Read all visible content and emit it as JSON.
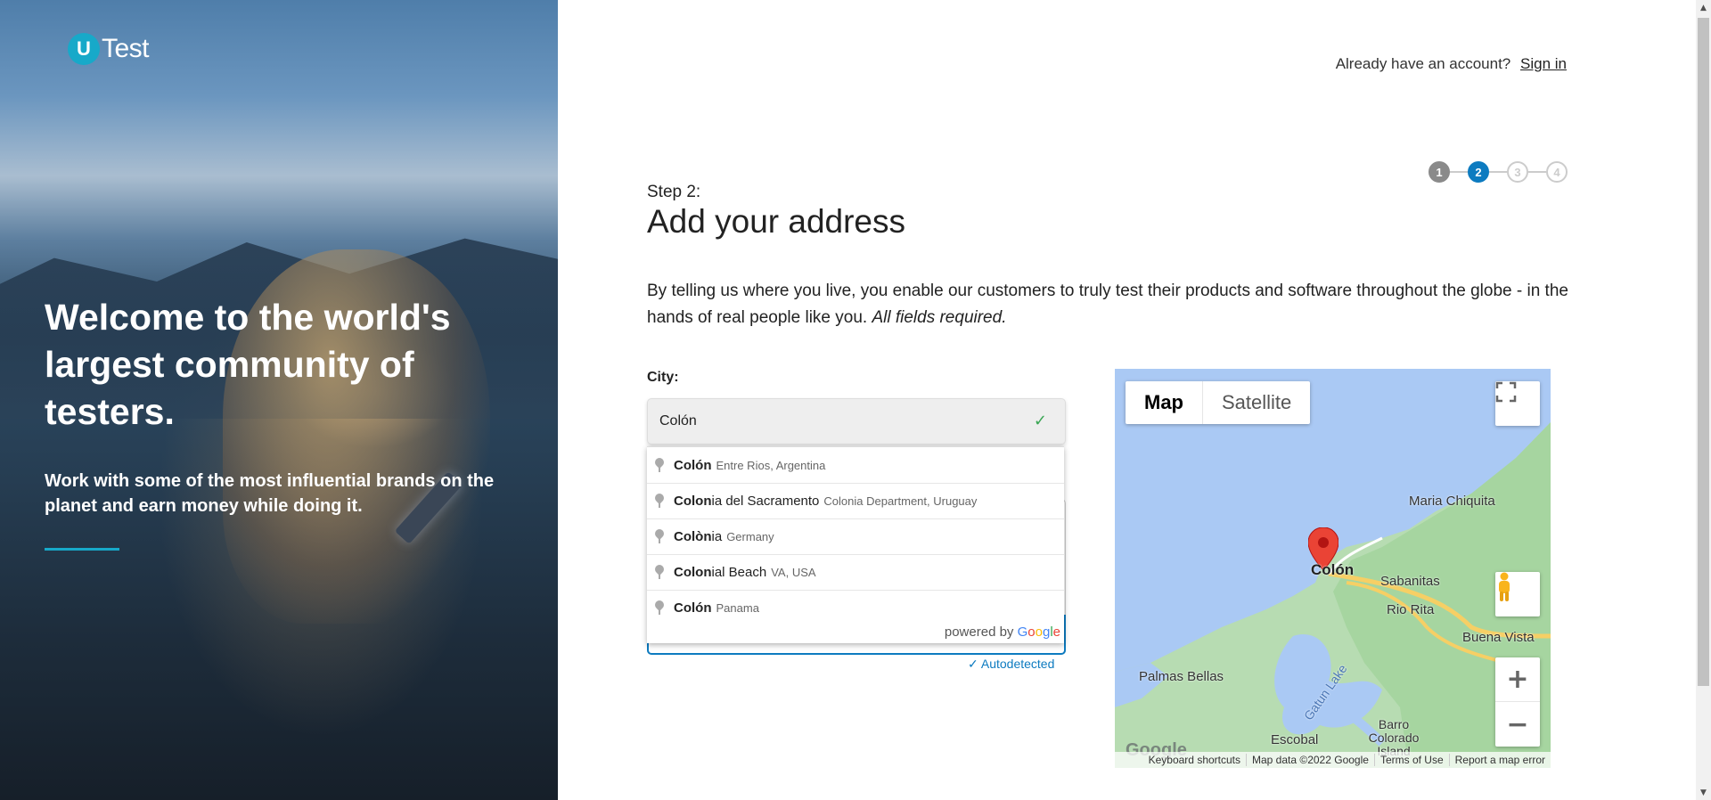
{
  "brand": {
    "logo_mark": "U",
    "logo_text": "Test"
  },
  "hero": {
    "title": "Welcome to the world's largest community of testers.",
    "subtitle": "Work with some of the most influential brands on the planet and earn money while doing it.",
    "accent_color": "#17a9c9"
  },
  "header": {
    "prompt": "Already have an account?",
    "signin_label": "Sign in"
  },
  "steps": {
    "items": [
      "1",
      "2",
      "3",
      "4"
    ],
    "current": 2
  },
  "form": {
    "step_label": "Step 2:",
    "title": "Add your address",
    "intro": "By telling us where you live, you enable our customers to truly test their products and software throughout the globe - in the hands of real people like you.",
    "intro_emphasis": "All fields required.",
    "city_label": "City:",
    "city_value": "Colón",
    "autodetected": "Autodetected"
  },
  "autocomplete": {
    "items": [
      {
        "match": "Colón",
        "rest": "",
        "secondary": "Entre Rios, Argentina"
      },
      {
        "match": "Colon",
        "rest": "ia del Sacramento",
        "secondary": "Colonia Department, Uruguay"
      },
      {
        "match": "Colòn",
        "rest": "ia",
        "secondary": "Germany"
      },
      {
        "match": "Colon",
        "rest": "ial Beach",
        "secondary": "VA, USA"
      },
      {
        "match": "Colón",
        "rest": "",
        "secondary": "Panama"
      }
    ],
    "powered_by": "powered by",
    "google": "Google"
  },
  "map": {
    "type_buttons": [
      "Map",
      "Satellite"
    ],
    "labels": {
      "maria_chiquita": "Maria Chiquita",
      "colon": "Colón",
      "sabanitas": "Sabanitas",
      "rio_rita": "Rio Rita",
      "buena_vista": "Buena Vista",
      "palmas_bellas": "Palmas Bellas",
      "gatun_lake": "Gatun Lake",
      "escobal": "Escobal",
      "barro_colorado": "Barro Colorado Island"
    },
    "footer": [
      "Keyboard shortcuts",
      "Map data ©2022 Google",
      "Terms of Use",
      "Report a map error"
    ],
    "watermark": "Google"
  }
}
